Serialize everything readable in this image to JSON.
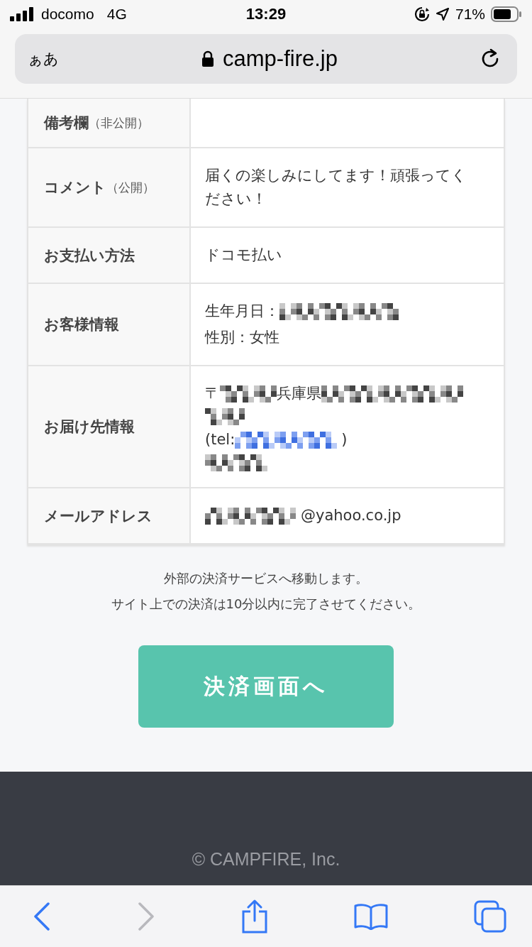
{
  "status_bar": {
    "carrier": "docomo",
    "network": "4G",
    "time": "13:29",
    "battery": "71%"
  },
  "address_bar": {
    "text_size": "ぁあ",
    "url": "camp-fire.jp"
  },
  "table": {
    "rows": [
      {
        "label": "備考欄",
        "note": "（非公開）",
        "lines": []
      },
      {
        "label": "コメント",
        "note": "（公開）",
        "lines": [
          [
            {
              "kind": "text",
              "text": "届くの楽しみにしてます！頑張ってください！"
            }
          ]
        ]
      },
      {
        "label": "お支払い方法",
        "lines": [
          [
            {
              "kind": "text",
              "text": "ドコモ払い"
            }
          ]
        ]
      },
      {
        "label": "お客様情報",
        "lines": [
          [
            {
              "kind": "text",
              "text": "生年月日："
            },
            {
              "kind": "redacted"
            }
          ],
          [
            {
              "kind": "text",
              "text": "性別：女性"
            }
          ]
        ]
      },
      {
        "label": "お届け先情報",
        "lines": [
          [
            {
              "kind": "text",
              "text": "〒"
            },
            {
              "kind": "redacted"
            },
            {
              "kind": "text",
              "text": "兵庫県"
            },
            {
              "kind": "redacted"
            }
          ],
          [
            {
              "kind": "redacted"
            }
          ],
          [
            {
              "kind": "text",
              "text": "(tel:"
            },
            {
              "kind": "redacted-link"
            },
            {
              "kind": "text",
              "text": ")"
            }
          ],
          [
            {
              "kind": "redacted"
            }
          ]
        ]
      },
      {
        "label": "メールアドレス",
        "lines": [
          [
            {
              "kind": "redacted"
            },
            {
              "kind": "text",
              "text": "@yahoo.co.jp"
            }
          ]
        ]
      }
    ]
  },
  "notice": [
    "外部の決済サービスへ移動します。",
    "サイト上での決済は10分以内に完了させてください。"
  ],
  "pay_button": "決済画面へ",
  "footer": "© CAMPFIRE, Inc.",
  "toolbar": [
    {
      "kind": "back",
      "disabled": false
    },
    {
      "kind": "forward",
      "disabled": true
    },
    {
      "kind": "share",
      "disabled": false
    },
    {
      "kind": "bookmarks",
      "disabled": false
    },
    {
      "kind": "tabs",
      "disabled": false
    }
  ]
}
